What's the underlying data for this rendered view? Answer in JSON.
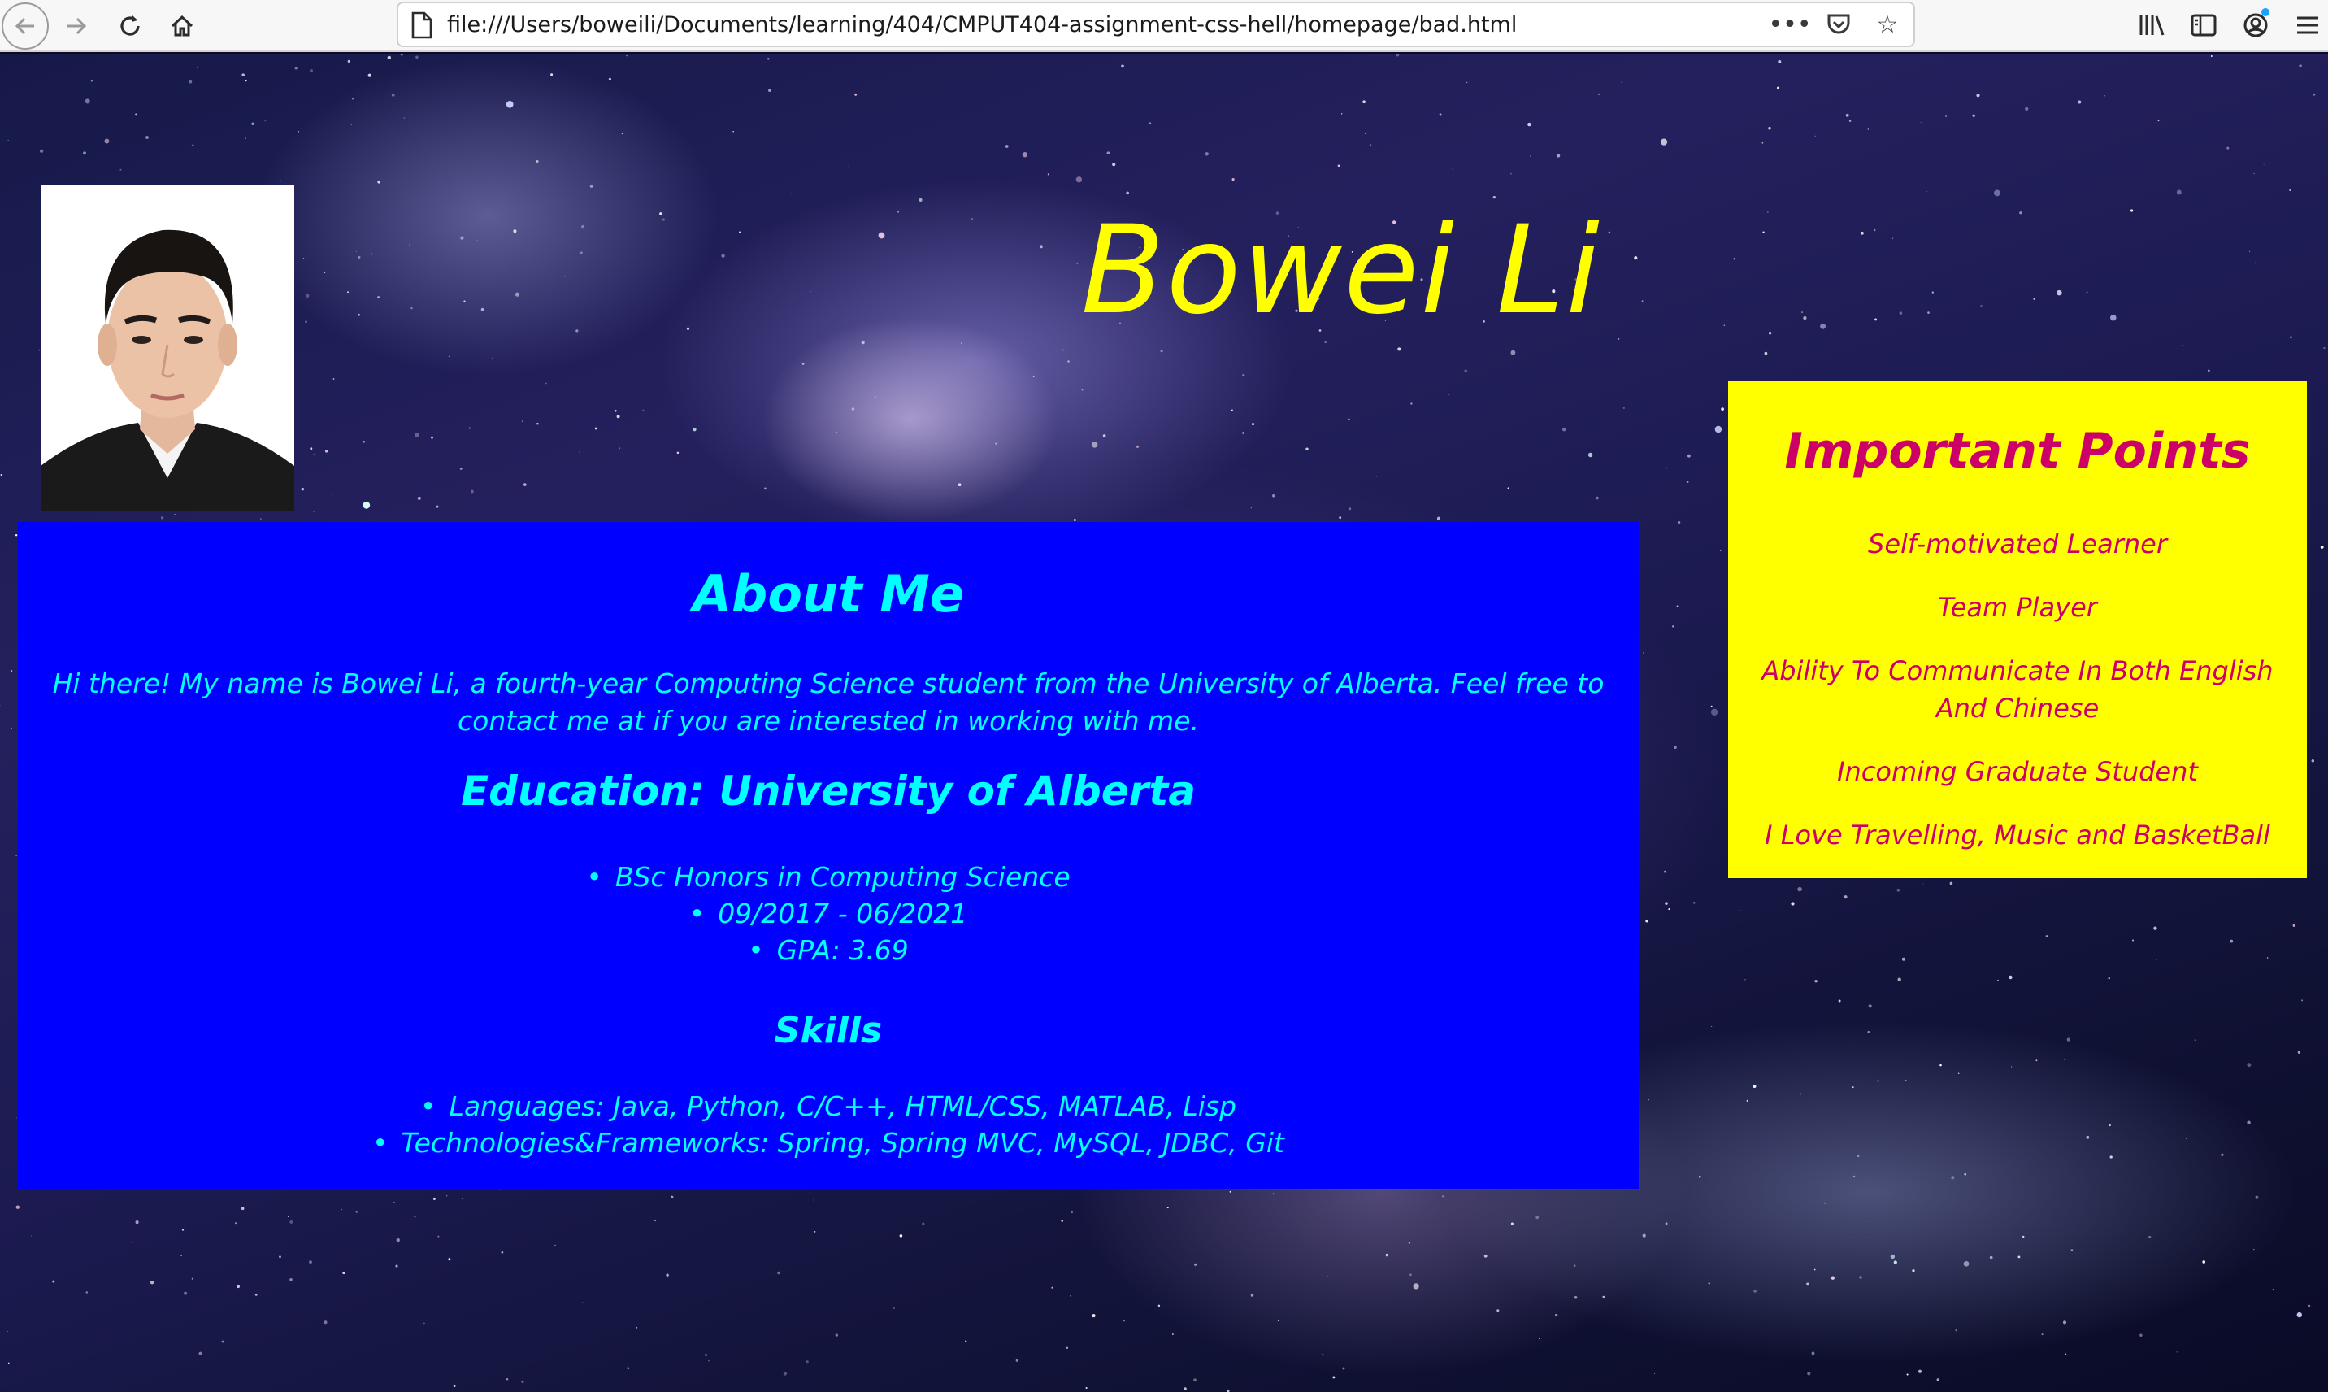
{
  "browser": {
    "url": "file:///Users/boweili/Documents/learning/404/CMPUT404-assignment-css-hell/homepage/bad.html",
    "icons": {
      "back": "back-arrow-icon",
      "forward": "forward-arrow-icon",
      "reload": "reload-icon",
      "home": "home-icon",
      "page": "page-icon",
      "more": "more-actions-icon",
      "pocket": "pocket-icon",
      "bookmark": "bookmark-star-icon",
      "library": "library-icon",
      "sidebar": "sidebar-icon",
      "account": "account-icon",
      "menu": "hamburger-menu-icon"
    }
  },
  "page": {
    "name": "Bowei Li",
    "colors": {
      "name": "#ffff00",
      "about_bg": "#0000ff",
      "about_text": "#00ffff",
      "points_bg": "#ffff00",
      "points_text": "#cc0066"
    },
    "about": {
      "title": "About Me",
      "intro": "Hi there! My name is Bowei Li, a fourth-year Computing Science student from the University of Alberta. Feel free to contact me at if you are interested in working with me.",
      "education_title": "Education: University of Alberta",
      "education_items": [
        "BSc Honors in Computing Science",
        "09/2017 - 06/2021",
        "GPA: 3.69"
      ],
      "skills_title": "Skills",
      "skills_items": [
        "Languages: Java, Python, C/C++, HTML/CSS, MATLAB, Lisp",
        "Technologies&Frameworks: Spring, Spring MVC, MySQL, JDBC, Git"
      ]
    },
    "points": {
      "title": "Important Points",
      "items": [
        "Self-motivated Learner",
        "Team Player",
        "Ability To Communicate In Both English And Chinese",
        "Incoming Graduate Student",
        "I Love Travelling, Music and BasketBall"
      ]
    }
  }
}
